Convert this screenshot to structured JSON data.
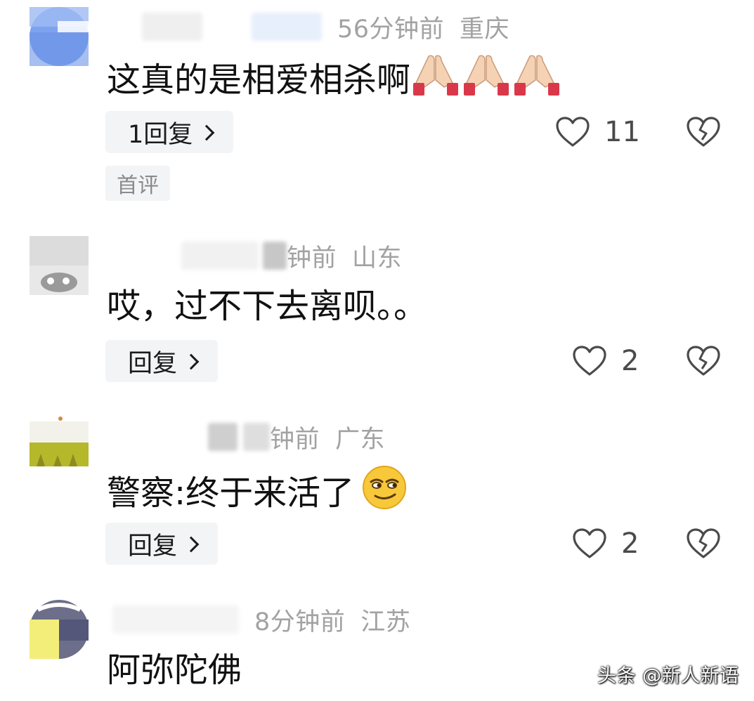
{
  "comments": [
    {
      "time": "56分钟前",
      "location": "重庆",
      "text": "这真的是相爱相杀啊",
      "emoji": "praying-hands",
      "emoji_count": 3,
      "reply_label": "1回复",
      "like_count": "11",
      "tag": "首评"
    },
    {
      "time": "钟前",
      "location": "山东",
      "text": "哎，过不下去离呗。。",
      "reply_label": "回复",
      "like_count": "2"
    },
    {
      "time": "钟前",
      "location": "广东",
      "text": "警察:终于来活了",
      "emoji": "smirk-face",
      "reply_label": "回复",
      "like_count": "2"
    },
    {
      "time": "8分钟前",
      "location": "江苏",
      "text": "阿弥陀佛"
    }
  ],
  "watermark": "头条 @新人新语",
  "colors": {
    "meta_gray": "#a2a2a2",
    "reply_bg": "#f3f4f6",
    "icon_gray": "#4a4a4a"
  }
}
